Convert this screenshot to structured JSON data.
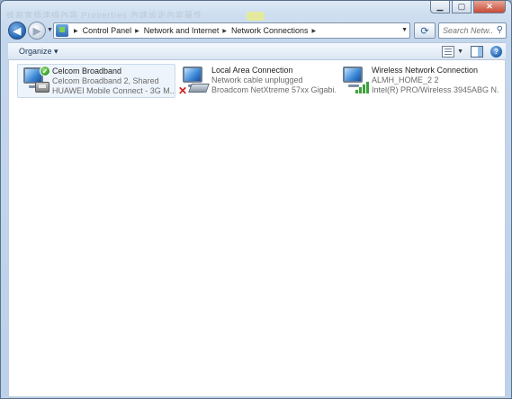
{
  "titlebar": {
    "ghost_text": "蜂窩寬頻連線內容 Properties  內建設定內容屬性",
    "minimize_label": "▁",
    "maximize_label": "▢",
    "close_label": "✕"
  },
  "navigation": {
    "back_label": "◀",
    "forward_label": "▶",
    "recent_label": "▼",
    "breadcrumbs": [
      "Control Panel",
      "Network and Internet",
      "Network Connections"
    ],
    "separator": "▶",
    "dropdown_label": "▼",
    "refresh_label": "⟳"
  },
  "search": {
    "placeholder": "Search Netw...",
    "icon_label": "⚲"
  },
  "toolbar": {
    "organize_label": "Organize ▾",
    "views_dropdown_label": "▼",
    "help_label": "?"
  },
  "connections": [
    {
      "name": "Celcom Broadband",
      "status": "Celcom Broadband  2, Shared",
      "device": "HUAWEI Mobile Connect - 3G M...",
      "icon": "mobile-broadband-connected-icon",
      "selected": true
    },
    {
      "name": "Local Area Connection",
      "status": "Network cable unplugged",
      "device": "Broadcom NetXtreme 57xx Gigabi...",
      "icon": "lan-disconnected-icon",
      "selected": false
    },
    {
      "name": "Wireless Network Connection",
      "status": "ALMH_HOME_2  2",
      "device": "Intel(R) PRO/Wireless 3945ABG N...",
      "icon": "wireless-connected-icon",
      "selected": false
    }
  ],
  "icons": {
    "check_mark": "✓",
    "error_mark": "✕"
  },
  "colors": {
    "window_frame": "#c3d6ec",
    "selection_background": "#eef4fb",
    "close_button": "#c74a35"
  }
}
